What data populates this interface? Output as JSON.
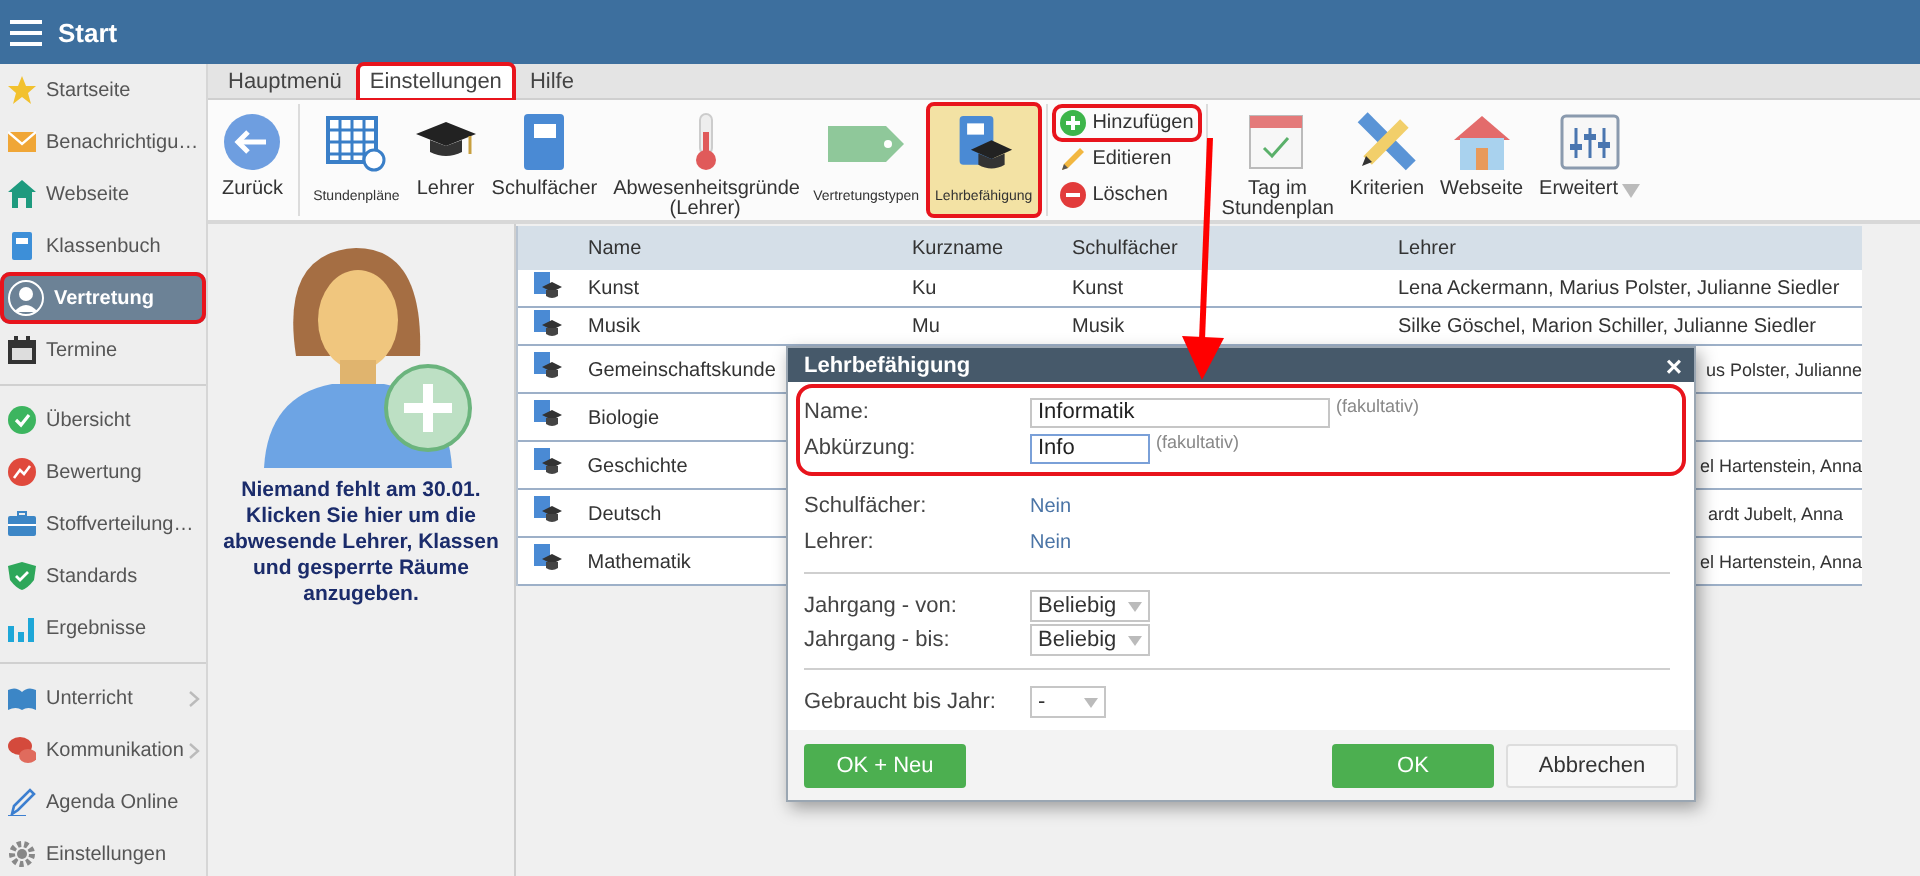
{
  "header": {
    "title": "Start"
  },
  "sidebar": {
    "groups": [
      {
        "items": [
          {
            "label": "Startseite",
            "selected": false,
            "highlighted": false,
            "expandable": false
          },
          {
            "label": "Benachrichtigu…",
            "selected": false,
            "highlighted": false,
            "expandable": false
          },
          {
            "label": "Webseite",
            "selected": false,
            "highlighted": false,
            "expandable": false
          },
          {
            "label": "Klassenbuch",
            "selected": false,
            "highlighted": false,
            "expandable": false
          },
          {
            "label": "Vertretung",
            "selected": true,
            "highlighted": true,
            "expandable": false
          },
          {
            "label": "Termine",
            "selected": false,
            "highlighted": false,
            "expandable": false
          }
        ]
      },
      {
        "items": [
          {
            "label": "Übersicht",
            "selected": false,
            "highlighted": false,
            "expandable": false
          },
          {
            "label": "Bewertung",
            "selected": false,
            "highlighted": false,
            "expandable": false
          },
          {
            "label": "Stoffverteilung…",
            "selected": false,
            "highlighted": false,
            "expandable": false
          },
          {
            "label": "Standards",
            "selected": false,
            "highlighted": false,
            "expandable": false
          },
          {
            "label": "Ergebnisse",
            "selected": false,
            "highlighted": false,
            "expandable": false
          }
        ]
      },
      {
        "items": [
          {
            "label": "Unterricht",
            "selected": false,
            "highlighted": false,
            "expandable": true
          },
          {
            "label": "Kommunikation",
            "selected": false,
            "highlighted": false,
            "expandable": true
          },
          {
            "label": "Agenda Online",
            "selected": false,
            "highlighted": false,
            "expandable": false
          },
          {
            "label": "Einstellungen",
            "selected": false,
            "highlighted": false,
            "expandable": false
          }
        ]
      }
    ]
  },
  "tabs": [
    {
      "label": "Hauptmenü",
      "selected": false,
      "highlighted": false
    },
    {
      "label": "Einstellungen",
      "selected": true,
      "highlighted": true
    },
    {
      "label": "Hilfe",
      "selected": false,
      "highlighted": false
    }
  ],
  "toolbar": {
    "groups": [
      {
        "kind": "large",
        "items": [
          {
            "label": "Zurück",
            "selected": false,
            "highlighted": false
          }
        ]
      },
      {
        "kind": "large",
        "items": [
          {
            "label": "Stundenpläne",
            "selected": false,
            "highlighted": false
          },
          {
            "label": "Lehrer",
            "selected": false,
            "highlighted": false
          },
          {
            "label": "Schulfächer",
            "selected": false,
            "highlighted": false
          },
          {
            "label": "Abwesenheitsgründe (Lehrer)",
            "selected": false,
            "highlighted": false
          },
          {
            "label": "Vertretungstypen",
            "selected": false,
            "highlighted": false
          },
          {
            "label": "Lehrbefähigung",
            "selected": true,
            "highlighted": true
          }
        ]
      },
      {
        "kind": "small",
        "items": [
          {
            "label": "Hinzufügen",
            "highlighted": true
          },
          {
            "label": "Editieren",
            "highlighted": false
          },
          {
            "label": "Löschen",
            "highlighted": false
          }
        ]
      },
      {
        "kind": "large",
        "items": [
          {
            "label": "Tag im Stundenplan",
            "selected": false,
            "highlighted": false
          },
          {
            "label": "Kriterien",
            "selected": false,
            "highlighted": false
          },
          {
            "label": "Webseite",
            "selected": false,
            "highlighted": false
          },
          {
            "label": "Erweitert",
            "selected": false,
            "highlighted": false,
            "dropdown": true
          }
        ]
      }
    ]
  },
  "absence_panel": {
    "title": "Niemand fehlt am 30.01.",
    "text": "Klicken Sie hier um die abwesende Lehrer, Klassen und gesperrte Räume anzugeben."
  },
  "table": {
    "columns": [
      "Name",
      "Kurzname",
      "Schulfächer",
      "Lehrer"
    ],
    "rows": [
      {
        "name": "Kunst",
        "kurzname": "Ku",
        "schulfaecher": "Kunst",
        "lehrer": "Lena Ackermann, Marius Polster, Julianne Siedler"
      },
      {
        "name": "Musik",
        "kurzname": "Mu",
        "schulfaecher": "Musik",
        "lehrer": "Silke Göschel, Marion Schiller, Julianne Siedler"
      },
      {
        "name": "Gemeinschaftskunde",
        "lehrer": "us Polster, Julianne"
      },
      {
        "name": "Biologie"
      },
      {
        "name": "Geschichte",
        "lehrer": "el Hartenstein, Anna"
      },
      {
        "name": "Deutsch",
        "lehrer": "ardt Jubelt, Anna"
      },
      {
        "name": "Mathematik",
        "lehrer": "el Hartenstein, Anna"
      }
    ]
  },
  "dialog": {
    "title": "Lehrbefähigung",
    "close": "×",
    "fields_highlighted": true,
    "fields": [
      {
        "label": "Name:",
        "value": "Informatik",
        "focused": false,
        "hint": "(fakultativ)"
      },
      {
        "label": "Abkürzung:",
        "value": "Info",
        "focused": true,
        "hint": "(fakultativ)"
      }
    ],
    "info": [
      {
        "label": "Schulfächer:",
        "value": "Nein"
      },
      {
        "label": "Lehrer:",
        "value": "Nein"
      }
    ],
    "selects": [
      [
        {
          "label": "Jahrgang - von:",
          "value": "Beliebig"
        },
        {
          "label": "Jahrgang - bis:",
          "value": "Beliebig"
        }
      ],
      [
        {
          "label": "Gebraucht bis Jahr:",
          "value": "-"
        }
      ]
    ],
    "buttons": [
      {
        "label": "OK + Neu",
        "kind": "primary"
      },
      {
        "label": "OK",
        "kind": "primary"
      },
      {
        "label": "Abbrechen",
        "kind": "secondary"
      }
    ]
  },
  "annotation_arrow": true
}
